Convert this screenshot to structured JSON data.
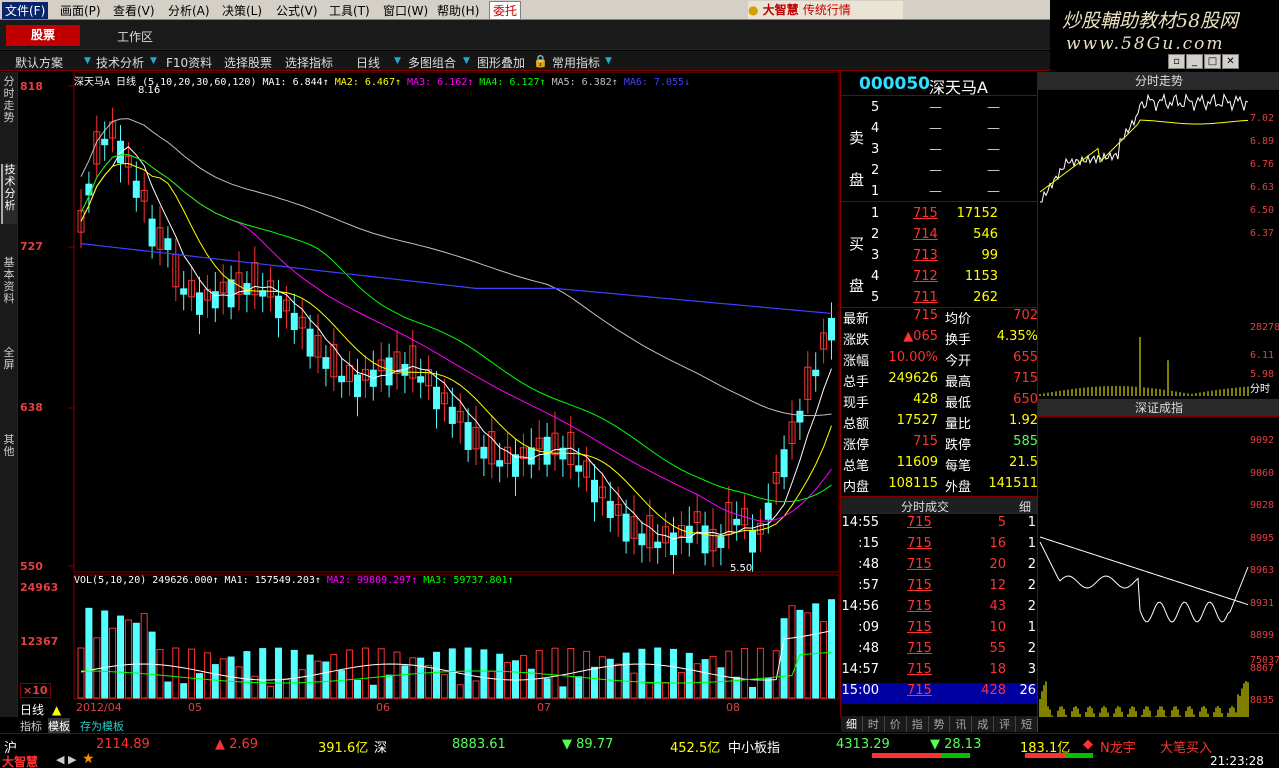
{
  "menu": [
    "文件(F)",
    "画面(P)",
    "查看(V)",
    "分析(A)",
    "决策(L)",
    "公式(V)",
    "工具(T)",
    "窗口(W)",
    "帮助(H)"
  ],
  "entrust": "委托",
  "brand": {
    "name": "大智慧",
    "sub": "传统行情"
  },
  "watermark": {
    "line1": "炒股輔助教材58股网",
    "line2": "www.58Gu.com"
  },
  "tabs": {
    "stock": "股票",
    "workarea": "工作区"
  },
  "toolbar": [
    "默认方案",
    "技术分析",
    "F10资料",
    "选择股票",
    "选择指标",
    "日线",
    "多图组合",
    "图形叠加",
    "常用指标"
  ],
  "left_tabs": [
    "分时走势",
    "技术分析",
    "基本资料",
    "全屏",
    "其他"
  ],
  "stock": {
    "code": "000050",
    "name": "深天马A",
    "title": "深天马A 日线"
  },
  "ma_line": {
    "label": "(5,10,20,30,60,120)",
    "ma1": "MA1: 6.844↑",
    "ma2": "MA2: 6.467↑",
    "ma3": "MA3: 6.162↑",
    "ma4": "MA4: 6.127↑",
    "ma5": "MA5: 6.382↑",
    "ma6": "MA6: 7.055↓"
  },
  "vol_line": {
    "label": "VOL(5,10,20)",
    "val": "249626.000↑",
    "ma1": "MA1: 157549.203↑",
    "ma2": "MA2: 99809.297↑",
    "ma3": "MA3: 59737.801↑"
  },
  "yticks": [
    "818",
    "727",
    "638",
    "550"
  ],
  "vol_yticks": [
    "24963",
    "12367",
    "×10"
  ],
  "annotations": {
    "high": "8.16",
    "low": "5.50"
  },
  "xaxis": [
    "2012/04",
    "05",
    "06",
    "07",
    "08"
  ],
  "bottom_tabs": [
    "日线",
    "指标",
    "模板",
    "存为模板"
  ],
  "sell": [
    {
      "lvl": "5",
      "p": "—",
      "v": "—"
    },
    {
      "lvl": "4",
      "p": "—",
      "v": "—"
    },
    {
      "lvl": "3",
      "p": "—",
      "v": "—"
    },
    {
      "lvl": "2",
      "p": "—",
      "v": "—"
    },
    {
      "lvl": "1",
      "p": "—",
      "v": "—"
    }
  ],
  "sell_label": "卖盘",
  "buy": [
    {
      "lvl": "1",
      "p": "715",
      "v": "17152"
    },
    {
      "lvl": "2",
      "p": "714",
      "v": "546"
    },
    {
      "lvl": "3",
      "p": "713",
      "v": "99"
    },
    {
      "lvl": "4",
      "p": "712",
      "v": "1153"
    },
    {
      "lvl": "5",
      "p": "711",
      "v": "262"
    }
  ],
  "buy_label": "买盘",
  "stats": [
    [
      "最新",
      "715",
      "均价",
      "702"
    ],
    [
      "涨跌",
      "▲065",
      "换手",
      "4.35%"
    ],
    [
      "涨幅",
      "10.00%",
      "今开",
      "655"
    ],
    [
      "总手",
      "249626",
      "最高",
      "715"
    ],
    [
      "现手",
      "428",
      "最低",
      "650"
    ],
    [
      "总额",
      "17527",
      "量比",
      "1.92"
    ],
    [
      "涨停",
      "715",
      "跌停",
      "585"
    ],
    [
      "总笔",
      "11609",
      "每笔",
      "21.5"
    ],
    [
      "内盘",
      "108115",
      "外盘",
      "141511"
    ]
  ],
  "ticks_header": "分时成交",
  "ticks_header2": "细",
  "ticks": [
    [
      "14:55",
      "715",
      "5",
      "1"
    ],
    [
      ":15",
      "715",
      "16",
      "1"
    ],
    [
      ":48",
      "715",
      "20",
      "2"
    ],
    [
      ":57",
      "715",
      "12",
      "2"
    ],
    [
      "14:56",
      "715",
      "43",
      "2"
    ],
    [
      ":09",
      "715",
      "10",
      "1"
    ],
    [
      ":48",
      "715",
      "55",
      "2"
    ],
    [
      "14:57",
      "715",
      "18",
      "3"
    ],
    [
      "15:00",
      "715",
      "428",
      "26"
    ]
  ],
  "right_bottom_tabs": [
    "细",
    "时",
    "价",
    "指",
    "势",
    "讯",
    "成",
    "评",
    "短"
  ],
  "mini1": {
    "title": "分时走势",
    "ticks": [
      "7.02",
      "6.89",
      "6.76",
      "6.63",
      "6.50",
      "6.37",
      "6.11",
      "5.98"
    ],
    "vol": [
      "28278",
      "分时"
    ]
  },
  "mini2": {
    "title": "深证成指",
    "ticks": [
      "9092",
      "9060",
      "9028",
      "8995",
      "8963",
      "8931",
      "8899",
      "8867",
      "8835"
    ],
    "vol": [
      "75037"
    ]
  },
  "status": {
    "sh": "沪",
    "sh_idx": "2114.89",
    "sh_chg": "▲ 2.69",
    "sh_amt": "391.6亿",
    "sz": "深",
    "sz_idx": "8883.61",
    "sz_chg": "▼ 89.77",
    "sz_amt": "452.5亿",
    "sme": "中小板指",
    "sme_idx": "4313.29",
    "sme_chg": "▼ 28.13",
    "sme_amt": "183.1亿",
    "news": "N龙宇",
    "alert": "大笔买入",
    "time": "21:23:28",
    "logo": "大智慧"
  },
  "colors": {
    "up": "#ff3232",
    "down": "#54ffff",
    "bg": "#000000",
    "frame": "#800000",
    "ma1": "#ffffff",
    "ma2": "#ffff00",
    "ma3": "#ff00ff",
    "ma4": "#00ff00",
    "ma5": "#c0c0c0",
    "ma6": "#4040ff"
  }
}
